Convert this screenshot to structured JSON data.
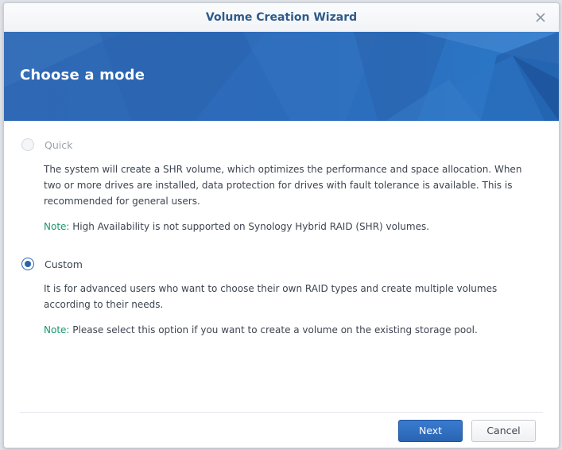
{
  "window": {
    "title": "Volume Creation Wizard",
    "close_icon": "close-icon"
  },
  "banner": {
    "title": "Choose a mode"
  },
  "options": {
    "quick": {
      "label": "Quick",
      "selected": false,
      "disabled": true,
      "description": "The system will create a SHR volume, which optimizes the performance and space allocation. When two or more drives are installed, data protection for drives with fault tolerance is available. This is recommended for general users.",
      "note_label": "Note:",
      "note_text": " High Availability is not supported on Synology Hybrid RAID (SHR) volumes."
    },
    "custom": {
      "label": "Custom",
      "selected": true,
      "disabled": false,
      "description": "It is for advanced users who want to choose their own RAID types and create multiple volumes according to their needs.",
      "note_label": "Note:",
      "note_text": " Please select this option if you want to create a volume on the existing storage pool."
    }
  },
  "footer": {
    "next_label": "Next",
    "cancel_label": "Cancel"
  },
  "colors": {
    "accent": "#2c64ac",
    "banner": "#2f68b4",
    "note_green": "#17986b",
    "title_blue": "#2e5a8a"
  }
}
